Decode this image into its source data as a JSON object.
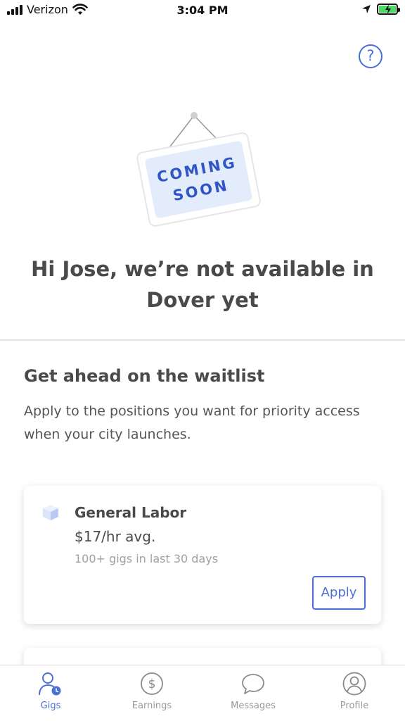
{
  "status_bar": {
    "carrier": "Verizon",
    "time": "3:04 PM"
  },
  "sign": {
    "line1": "COMING",
    "line2": "SOON"
  },
  "headline": "Hi Jose, we’re not available in Dover yet",
  "waitlist": {
    "title": "Get ahead on the waitlist",
    "description": "Apply to the positions you want for priority access when your city launches."
  },
  "jobs": [
    {
      "title": "General Labor",
      "pay": "$17/hr avg.",
      "gigs": "100+ gigs in last 30 days",
      "apply_label": "Apply"
    }
  ],
  "tabs": [
    {
      "label": "Gigs",
      "icon": "person-clock-icon",
      "active": true
    },
    {
      "label": "Earnings",
      "icon": "dollar-circle-icon",
      "active": false
    },
    {
      "label": "Messages",
      "icon": "chat-bubble-icon",
      "active": false
    },
    {
      "label": "Profile",
      "icon": "profile-circle-icon",
      "active": false
    }
  ],
  "colors": {
    "accent": "#4a6fd6",
    "text": "#4a4a4a",
    "muted": "#a0a0a0",
    "sign_fill": "#e3ecfb",
    "battery": "#4cd964"
  },
  "help_icon": "?"
}
